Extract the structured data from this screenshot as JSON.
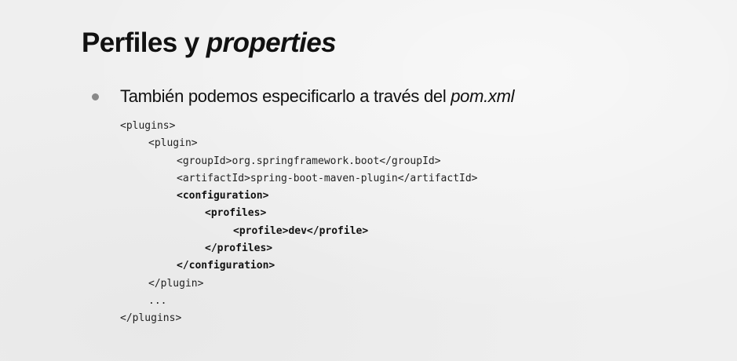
{
  "slide": {
    "title_main": "Perfiles y ",
    "title_italic": "properties",
    "bullet_text_main": "También podemos especificarlo a través del ",
    "bullet_text_italic": "pom.xml",
    "code_lines": [
      {
        "indent": 0,
        "bold": false,
        "text": "<plugins>"
      },
      {
        "indent": 1,
        "bold": false,
        "text": "<plugin>"
      },
      {
        "indent": 2,
        "bold": false,
        "text": "<groupId>org.springframework.boot</groupId>"
      },
      {
        "indent": 2,
        "bold": false,
        "text": "<artifactId>spring-boot-maven-plugin</artifactId>"
      },
      {
        "indent": 2,
        "bold": true,
        "text": "<configuration>"
      },
      {
        "indent": 3,
        "bold": true,
        "text": "<profiles>"
      },
      {
        "indent": 4,
        "bold": true,
        "text": "<profile>dev</profile>"
      },
      {
        "indent": 3,
        "bold": true,
        "text": "</profiles>"
      },
      {
        "indent": 2,
        "bold": true,
        "text": "</configuration>"
      },
      {
        "indent": 1,
        "bold": false,
        "text": "</plugin>"
      },
      {
        "indent": 1,
        "bold": false,
        "text": "..."
      },
      {
        "indent": 0,
        "bold": false,
        "text": "</plugins>"
      }
    ]
  }
}
